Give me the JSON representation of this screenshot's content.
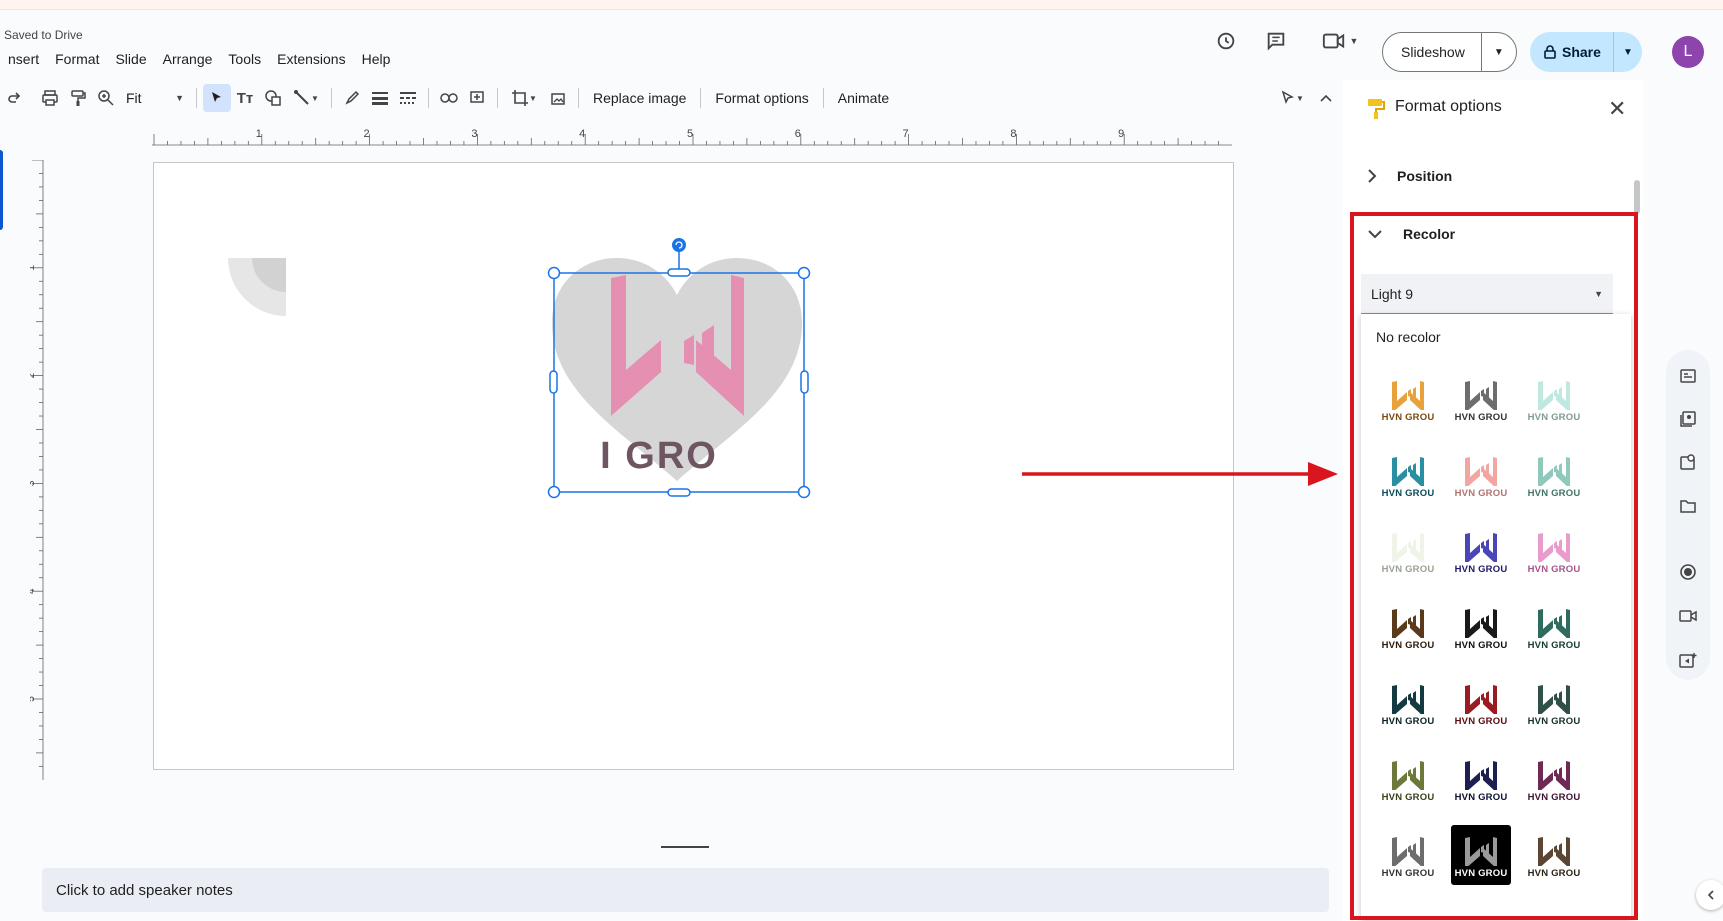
{
  "header": {
    "save_status": "Saved to Drive",
    "menu": [
      "nsert",
      "Format",
      "Slide",
      "Arrange",
      "Tools",
      "Extensions",
      "Help"
    ],
    "slideshow_label": "Slideshow",
    "share_label": "Share",
    "avatar_letter": "L"
  },
  "toolbar": {
    "zoom_value": "Fit",
    "replace_image_label": "Replace image",
    "format_options_label": "Format options",
    "animate_label": "Animate"
  },
  "ruler": {
    "horizontal": [
      "1",
      "2",
      "3",
      "4",
      "5",
      "6",
      "7",
      "8",
      "9"
    ],
    "vertical": [
      "1",
      "2",
      "3",
      "4",
      "5"
    ]
  },
  "slide": {
    "image_text": "I GRO"
  },
  "notes": {
    "placeholder": "Click to add speaker notes"
  },
  "panel": {
    "title": "Format options",
    "sections": {
      "position": "Position",
      "recolor": "Recolor"
    },
    "recolor_value": "Light 9",
    "no_recolor_label": "No recolor",
    "swatches": [
      {
        "caption": "HVN GROU",
        "color": "#e8a23c",
        "text_color": "#7a4a12"
      },
      {
        "caption": "HVN GROU",
        "color": "#6d6d6d",
        "text_color": "#333333"
      },
      {
        "caption": "HVN GROU",
        "color": "#bfe8e0",
        "text_color": "#7f9a95"
      },
      {
        "caption": "HVN GROU",
        "color": "#2a8fa3",
        "text_color": "#0b4a5a"
      },
      {
        "caption": "HVN GROU",
        "color": "#f3a6a1",
        "text_color": "#b07470"
      },
      {
        "caption": "HVN GROU",
        "color": "#8ec9bb",
        "text_color": "#3f7467"
      },
      {
        "caption": "HVN GROU",
        "color": "#eef5e8",
        "text_color": "#9aa294"
      },
      {
        "caption": "HVN GROU",
        "color": "#4a46b8",
        "text_color": "#1e1b6a"
      },
      {
        "caption": "HVN GROU",
        "color": "#e99ccb",
        "text_color": "#a6558a"
      },
      {
        "caption": "HVN GROU",
        "color": "#5a3a1a",
        "text_color": "#2d1a08"
      },
      {
        "caption": "HVN GROU",
        "color": "#1a1a1a",
        "text_color": "#111111"
      },
      {
        "caption": "HVN GROU",
        "color": "#2f6b5f",
        "text_color": "#153a33"
      },
      {
        "caption": "HVN GROU",
        "color": "#123a40",
        "text_color": "#0a2226"
      },
      {
        "caption": "HVN GROU",
        "color": "#9a1b22",
        "text_color": "#5a0c10"
      },
      {
        "caption": "HVN GROU",
        "color": "#2f4f48",
        "text_color": "#15302b"
      },
      {
        "caption": "HVN GROU",
        "color": "#6b7a3a",
        "text_color": "#38421a"
      },
      {
        "caption": "HVN GROU",
        "color": "#1c2050",
        "text_color": "#0d1030"
      },
      {
        "caption": "HVN GROU",
        "color": "#6e2a55",
        "text_color": "#3d1230"
      },
      {
        "caption": "HVN GROU",
        "color": "#6d6d6d",
        "text_color": "#333333"
      },
      {
        "caption": "HVN GROU",
        "color": "#9a9a9a",
        "text_color": "#ffffff",
        "selected": true
      },
      {
        "caption": "HVN GROU",
        "color": "#5a4632",
        "text_color": "#2d2216"
      }
    ]
  }
}
